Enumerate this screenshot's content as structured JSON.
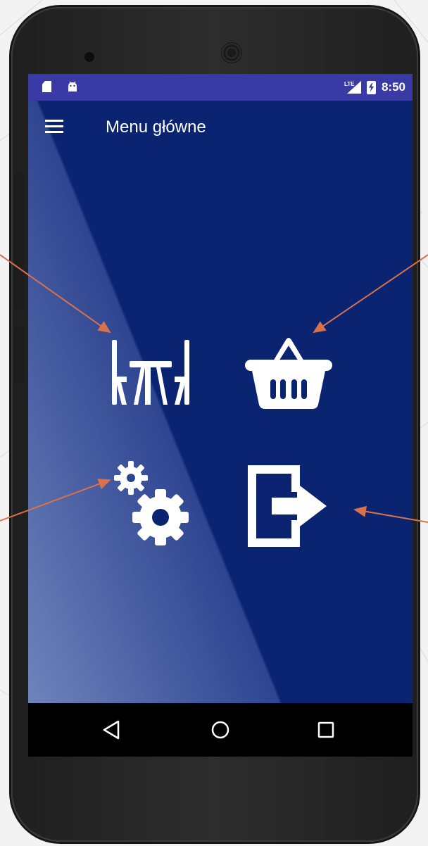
{
  "status_bar": {
    "network_label": "LTE",
    "time": "8:50"
  },
  "app_bar": {
    "title": "Menu główne"
  },
  "menu": {
    "tiles": [
      {
        "icon": "table-chairs-icon"
      },
      {
        "icon": "shopping-basket-icon"
      },
      {
        "icon": "settings-gears-icon"
      },
      {
        "icon": "logout-icon"
      }
    ]
  },
  "nav_bar": {
    "buttons": [
      "back-icon",
      "home-icon",
      "recents-icon"
    ]
  },
  "colors": {
    "status_bar": "#3a3aa6",
    "background_dark": "#0a2472",
    "background_light": "#6f83bb",
    "annotation_arrow": "#d9714a"
  }
}
